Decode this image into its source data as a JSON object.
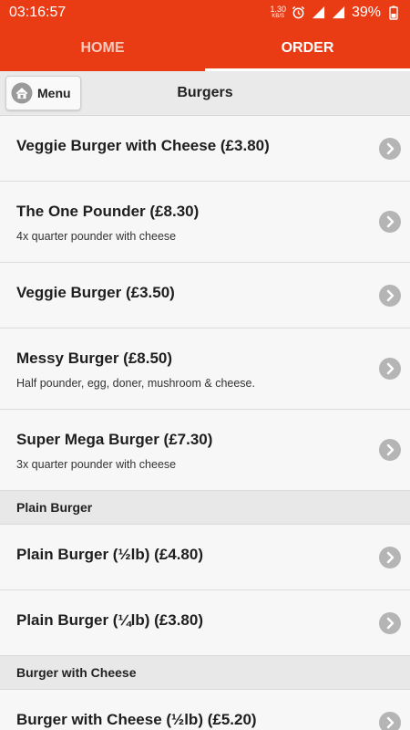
{
  "status_bar": {
    "time": "03:16:57",
    "net_speed_value": "1.30",
    "net_speed_unit": "KB/S",
    "battery": "39%",
    "icons": [
      "alarm-icon",
      "signal-icon",
      "signal-icon",
      "battery-icon"
    ]
  },
  "tabs": [
    {
      "label": "HOME",
      "active": false
    },
    {
      "label": "ORDER",
      "active": true
    }
  ],
  "header": {
    "menu_label": "Menu",
    "title": "Burgers"
  },
  "colors": {
    "brand": "#ea3c14",
    "chevron": "#b5b5b5"
  },
  "list": [
    {
      "type": "item",
      "name": "Veggie Burger with Cheese (£3.80)",
      "desc": ""
    },
    {
      "type": "item",
      "name": "The One Pounder (£8.30)",
      "desc": "4x quarter pounder with cheese"
    },
    {
      "type": "item",
      "name": "Veggie Burger (£3.50)",
      "desc": ""
    },
    {
      "type": "item",
      "name": "Messy Burger (£8.50)",
      "desc": "Half pounder, egg, doner, mushroom & cheese."
    },
    {
      "type": "item",
      "name": "Super Mega Burger (£7.30)",
      "desc": "3x quarter pounder with cheese"
    },
    {
      "type": "section",
      "name": "Plain Burger"
    },
    {
      "type": "item",
      "name": "Plain Burger (½lb) (£4.80)",
      "desc": ""
    },
    {
      "type": "item",
      "name": "Plain Burger (¼lb) (£3.80)",
      "desc": ""
    },
    {
      "type": "section",
      "name": "Burger with Cheese"
    },
    {
      "type": "item",
      "name": "Burger with Cheese (½lb) (£5.20)",
      "desc": ""
    }
  ]
}
